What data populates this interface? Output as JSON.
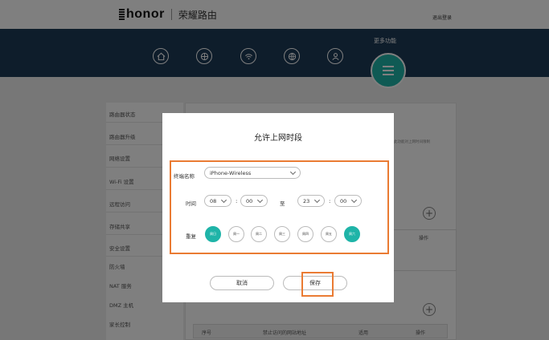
{
  "header": {
    "brand": "honor",
    "product": "荣耀路由",
    "logout": "退出登录"
  },
  "nav": {
    "more_label": "更多功能",
    "icons": [
      "home-icon",
      "globe-icon",
      "wifi-icon",
      "network-icon",
      "user-icon",
      "menu-icon"
    ]
  },
  "menu": {
    "items": [
      "路由器状态",
      "路由器升级",
      "网络设置",
      "Wi-Fi 设置",
      "远程访问",
      "存储共享",
      "安全设置",
      "防火墙",
      "NAT 服务",
      "DMZ 主机",
      "家长控制"
    ]
  },
  "panel": {
    "note": "此功能对上网时间限制",
    "op_header": "操作",
    "table": {
      "col_no": "序号",
      "col_site": "禁止访问的网站地址",
      "col_apply": "适用",
      "col_op": "操作"
    }
  },
  "dialog": {
    "title": "允许上网时段",
    "device_label": "终端名称",
    "device_value": "iPhone-Wireless",
    "time_label": "时间",
    "start_hour": "08",
    "start_min": "00",
    "to_label": "至",
    "end_hour": "23",
    "end_min": "00",
    "repeat_label": "重复",
    "days": [
      {
        "label": "周日",
        "selected": true
      },
      {
        "label": "周一",
        "selected": false
      },
      {
        "label": "周二",
        "selected": false
      },
      {
        "label": "周三",
        "selected": false
      },
      {
        "label": "周四",
        "selected": false
      },
      {
        "label": "周五",
        "selected": false
      },
      {
        "label": "周六",
        "selected": true
      }
    ],
    "cancel": "取消",
    "save": "保存"
  },
  "colors": {
    "accent": "#1fb4a8",
    "highlight": "#ea7b33",
    "nav_bg": "#1d3a57"
  }
}
